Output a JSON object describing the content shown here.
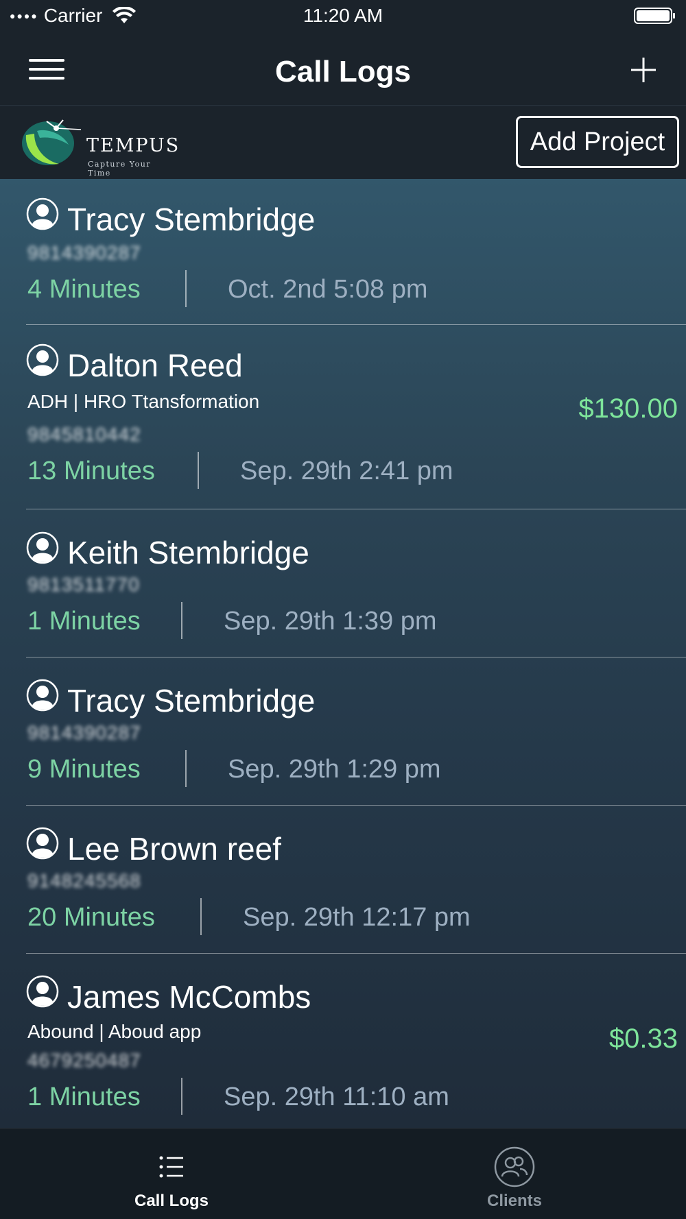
{
  "status_bar": {
    "carrier": "Carrier",
    "time": "11:20 AM"
  },
  "nav": {
    "title": "Call Logs",
    "menu_icon": "hamburger-menu-icon",
    "add_icon": "plus-icon"
  },
  "brand": {
    "logo_title": "TEMPUS",
    "logo_subtitle": "Capture Your Time",
    "add_project_label": "Add Project"
  },
  "calls": [
    {
      "name": "Tracy Stembridge",
      "project": "",
      "amount": "",
      "phone": "9814390287",
      "duration": "4 Minutes",
      "datetime": "Oct. 2nd 5:08 pm"
    },
    {
      "name": "Dalton Reed",
      "project": "ADH | HRO Ttansformation",
      "amount": "$130.00",
      "phone": "9845810442",
      "duration": "13 Minutes",
      "datetime": "Sep. 29th 2:41 pm"
    },
    {
      "name": "Keith Stembridge",
      "project": "",
      "amount": "",
      "phone": "9813511770",
      "duration": "1 Minutes",
      "datetime": "Sep. 29th 1:39 pm"
    },
    {
      "name": "Tracy Stembridge",
      "project": "",
      "amount": "",
      "phone": "9814390287",
      "duration": "9 Minutes",
      "datetime": "Sep. 29th 1:29 pm"
    },
    {
      "name": "Lee Brown reef",
      "project": "",
      "amount": "",
      "phone": "9148245568",
      "duration": "20 Minutes",
      "datetime": "Sep. 29th 12:17 pm"
    },
    {
      "name": "James McCombs",
      "project": "Abound | Aboud app",
      "amount": "$0.33",
      "phone": "4679250487",
      "duration": "1 Minutes",
      "datetime": "Sep. 29th 11:10 am"
    }
  ],
  "tabs": [
    {
      "label": "Call Logs",
      "icon": "list-icon",
      "active": true
    },
    {
      "label": "Clients",
      "icon": "clients-icon",
      "active": false
    }
  ],
  "colors": {
    "duration": "#7dd3a4",
    "amount": "#7ee59b",
    "datetime": "#9eb0c2"
  }
}
